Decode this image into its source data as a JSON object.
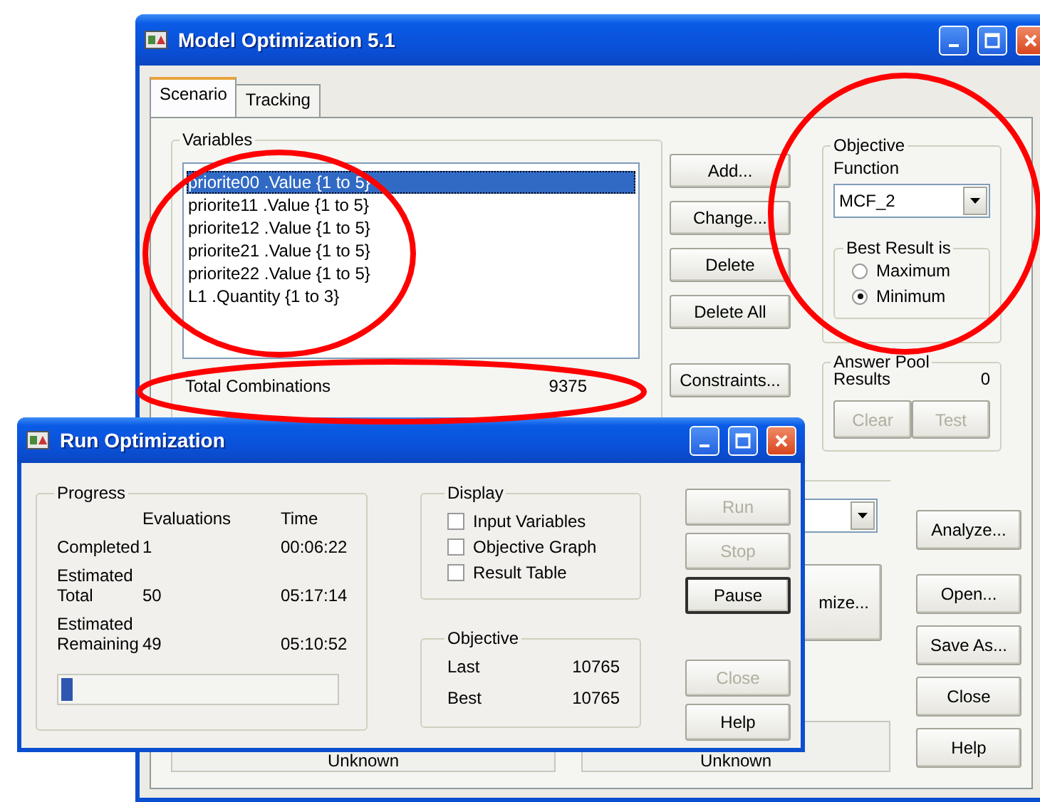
{
  "main_window": {
    "title": "Model Optimization 5.1"
  },
  "tabs": [
    {
      "label": "Scenario",
      "selected": true
    },
    {
      "label": "Tracking",
      "selected": false
    }
  ],
  "variables": {
    "title": "Variables",
    "items": [
      {
        "label": "priorite00 .Value {1 to 5}",
        "selected": true
      },
      {
        "label": "priorite11 .Value {1 to 5}",
        "selected": false
      },
      {
        "label": "priorite12 .Value {1 to 5}",
        "selected": false
      },
      {
        "label": "priorite21 .Value {1 to 5}",
        "selected": false
      },
      {
        "label": "priorite22 .Value {1 to 5}",
        "selected": false
      },
      {
        "label": "L1 .Quantity {1 to 3}",
        "selected": false
      }
    ],
    "total_label": "Total Combinations",
    "total_value": "9375"
  },
  "variable_buttons": [
    "Add...",
    "Change...",
    "Delete",
    "Delete All",
    "Constraints..."
  ],
  "objective": {
    "title": "Objective",
    "function_label": "Function",
    "function_value": "MCF_2",
    "best_title": "Best Result is",
    "options": [
      {
        "label": "Maximum",
        "selected": false
      },
      {
        "label": "Minimum",
        "selected": true
      }
    ]
  },
  "answer_pool": {
    "title": "Answer Pool",
    "results_label": "Results",
    "results_value": "0",
    "buttons": [
      {
        "label": "Clear",
        "disabled": true
      },
      {
        "label": "Test",
        "disabled": true
      }
    ]
  },
  "optimize_button": "mize...",
  "side_buttons": [
    "Analyze...",
    "Open...",
    "Save As...",
    "Close",
    "Help"
  ],
  "status_boxes": [
    "Unknown",
    "Unknown"
  ],
  "run_dialog": {
    "title": "Run Optimization",
    "progress": {
      "title": "Progress",
      "columns": [
        "Evaluations",
        "Time"
      ],
      "rows": [
        {
          "label": "Completed",
          "evaluations": "1",
          "time": "00:06:22"
        },
        {
          "label": "Estimated Total",
          "evaluations": "50",
          "time": "05:17:14"
        },
        {
          "label": "Estimated Remaining",
          "evaluations": "49",
          "time": "05:10:52"
        }
      ],
      "level": 0.04
    },
    "display": {
      "title": "Display",
      "options": [
        {
          "label": "Input Variables",
          "checked": false
        },
        {
          "label": "Objective Graph",
          "checked": false
        },
        {
          "label": "Result Table",
          "checked": false
        }
      ]
    },
    "objective": {
      "title": "Objective",
      "rows": [
        {
          "label": "Last",
          "value": "10765"
        },
        {
          "label": "Best",
          "value": "10765"
        }
      ]
    },
    "buttons": [
      {
        "label": "Run",
        "disabled": true,
        "default": false
      },
      {
        "label": "Stop",
        "disabled": true,
        "default": false
      },
      {
        "label": "Pause",
        "disabled": false,
        "default": true
      },
      {
        "label": "Close",
        "disabled": true,
        "default": false
      },
      {
        "label": "Help",
        "disabled": false,
        "default": false
      }
    ]
  },
  "annotations": [
    {
      "kind": "ellipse"
    },
    {
      "kind": "ellipse"
    },
    {
      "kind": "ellipse"
    }
  ]
}
